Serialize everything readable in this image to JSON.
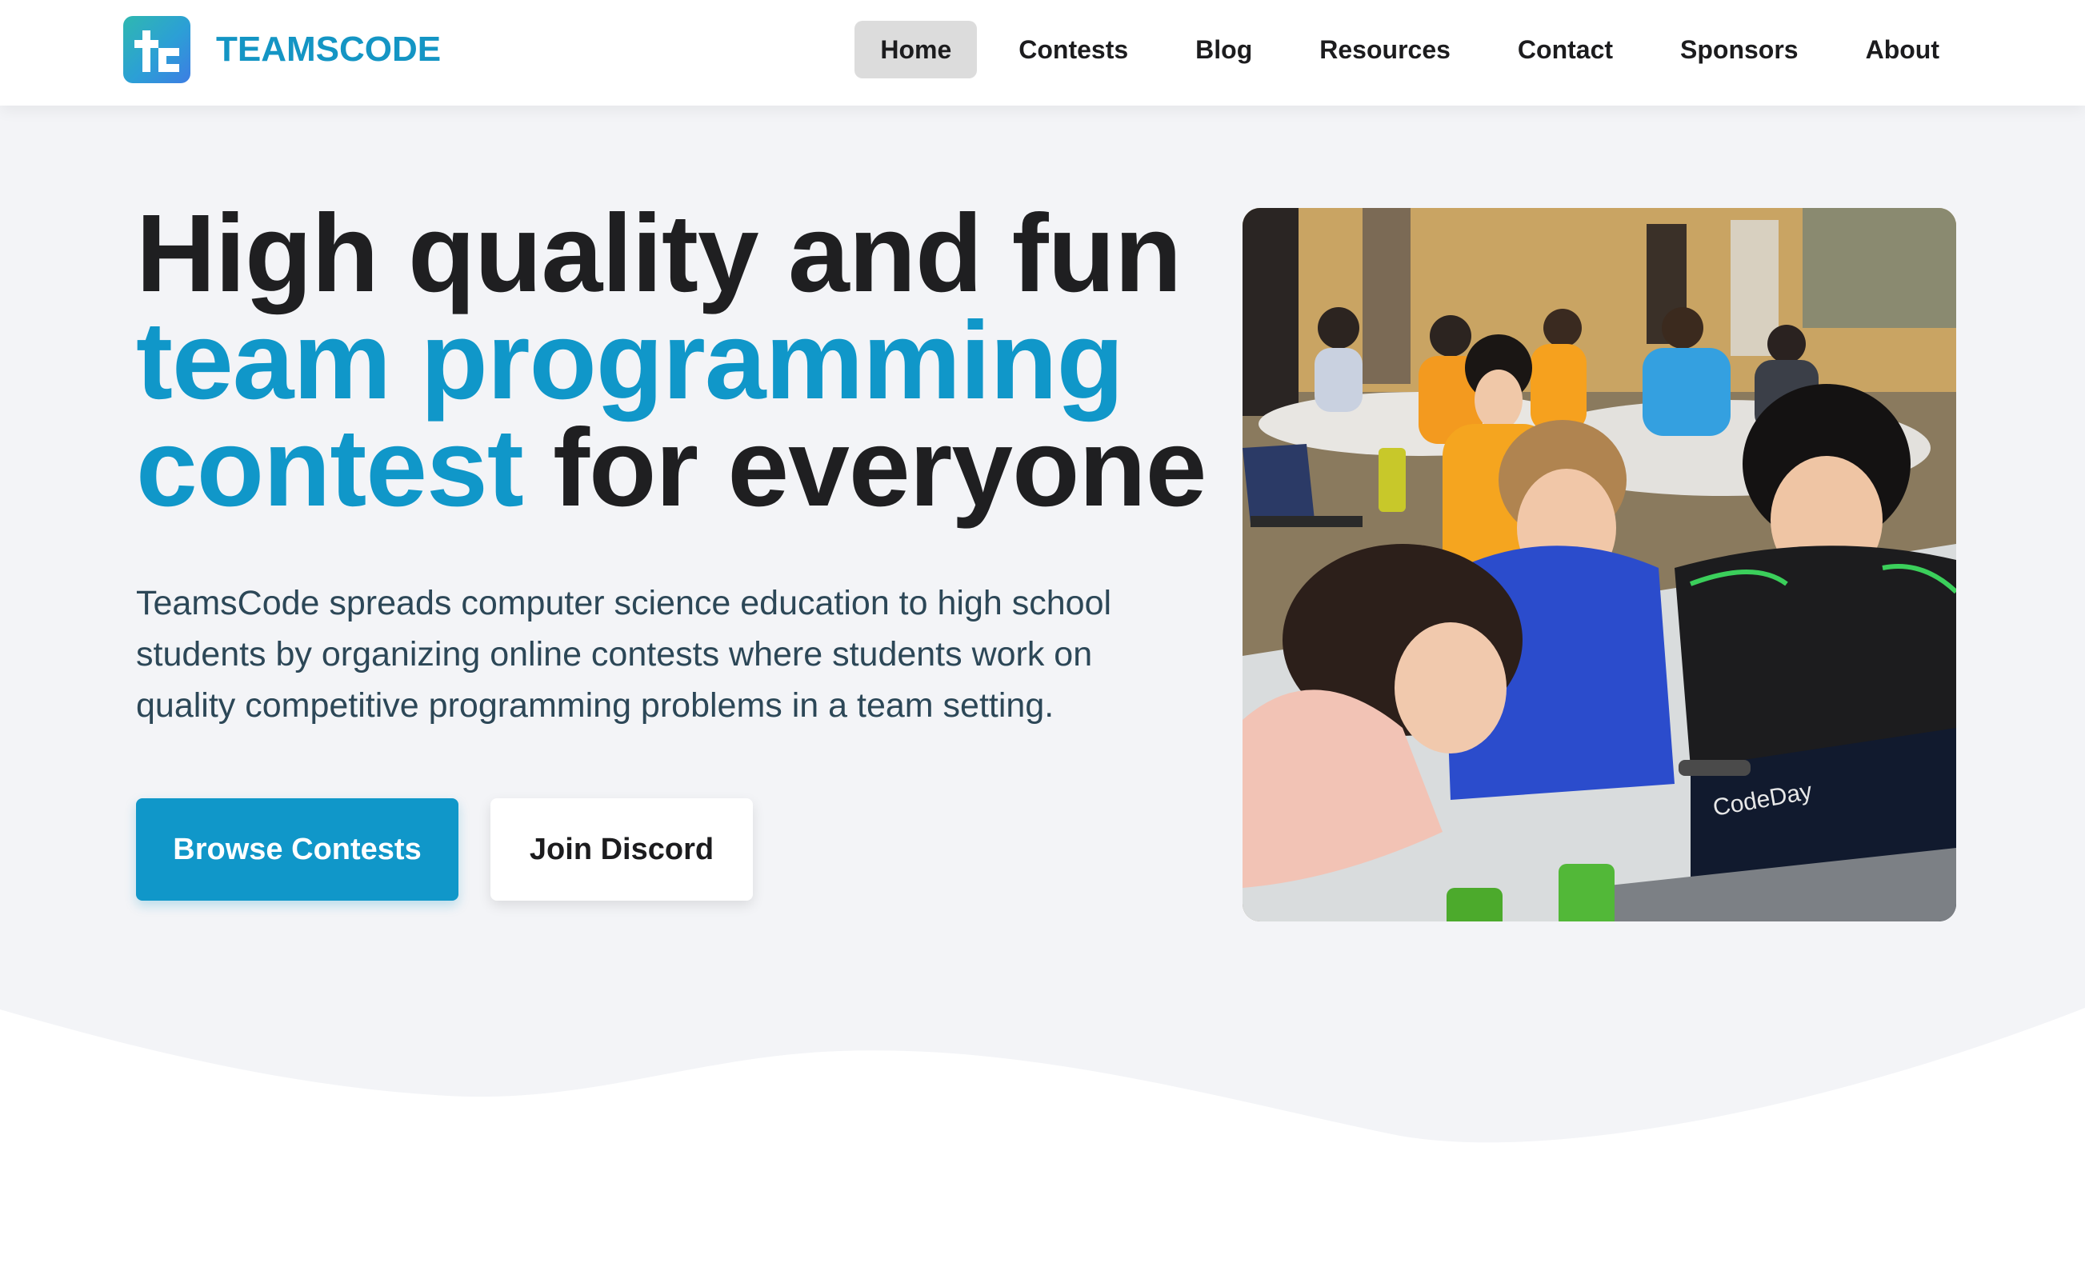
{
  "brand": {
    "name": "TEAMSCODE",
    "logo_icon": "teamscode-logo-icon"
  },
  "nav": {
    "items": [
      {
        "label": "Home",
        "active": true
      },
      {
        "label": "Contests",
        "active": false
      },
      {
        "label": "Blog",
        "active": false
      },
      {
        "label": "Resources",
        "active": false
      },
      {
        "label": "Contact",
        "active": false
      },
      {
        "label": "Sponsors",
        "active": false
      },
      {
        "label": "About",
        "active": false
      }
    ]
  },
  "hero": {
    "headline_line1": "High quality and fun",
    "headline_line2": "team programming",
    "headline_line3_highlight": "contest",
    "headline_line3_rest": " for everyone",
    "description": "TeamsCode spreads computer science education to high school students by organizing online contests where students work on quality competitive programming problems in a team setting.",
    "primary_button": "Browse Contests",
    "secondary_button": "Join Discord"
  },
  "colors": {
    "accent": "#1097c9",
    "heading": "#1f1f21",
    "body_text": "#2c4757",
    "page_bg": "#f3f4f7",
    "nav_active_bg": "#dcdcdc"
  }
}
